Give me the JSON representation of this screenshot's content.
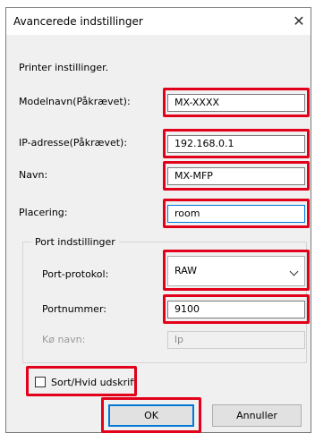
{
  "dialog": {
    "title": "Avancerede indstillinger",
    "close_glyph": "✕"
  },
  "section_label": "Printer instillinger.",
  "fields": {
    "model": {
      "label": "Modelnavn(Påkrævet):",
      "value": "MX-XXXX"
    },
    "ip": {
      "label": "IP-adresse(Påkrævet):",
      "value": "192.168.0.1"
    },
    "name": {
      "label": "Navn:",
      "value": "MX-MFP"
    },
    "location": {
      "label": "Placering:",
      "value": "room"
    }
  },
  "port_settings": {
    "group_title": "Port indstillinger",
    "protocol": {
      "label": "Port-protokol:",
      "selected": "RAW"
    },
    "port_number": {
      "label": "Portnummer:",
      "value": "9100"
    },
    "queue": {
      "label": "Kø navn:",
      "value": "lp"
    }
  },
  "checkbox": {
    "label": "Sort/Hvid udskrift",
    "checked": false
  },
  "buttons": {
    "ok": "OK",
    "cancel": "Annuller"
  },
  "colors": {
    "highlight": "#e3001b",
    "focus": "#0078d7",
    "dialog_bg": "#f0f0f0"
  },
  "icons": {
    "close": "close-icon",
    "dropdown": "chevron-down-icon"
  }
}
